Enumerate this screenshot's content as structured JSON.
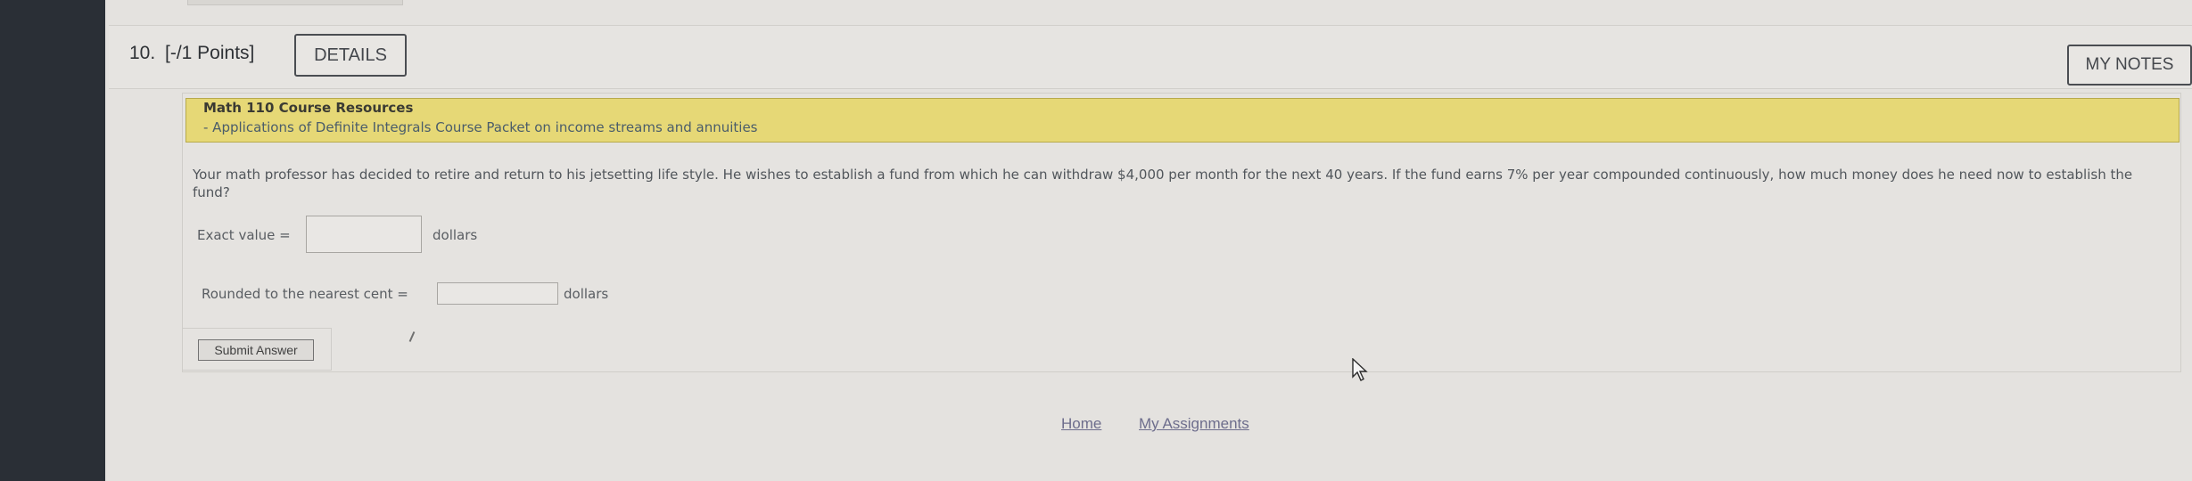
{
  "question": {
    "number": "10.",
    "points": "[-/1 Points]",
    "details_label": "DETAILS",
    "notes_label": "MY NOTES"
  },
  "resources": {
    "title": "Math 110 Course Resources",
    "subtitle": "- Applications of Definite Integrals Course Packet on income streams and annuities"
  },
  "problem": {
    "text": "Your math professor has decided to retire and return to his jetsetting life style. He wishes to establish a fund from which he can withdraw $4,000 per month for the next 40 years. If the fund earns 7% per year compounded continuously, how much money does he need now to establish the fund?",
    "exact_label": "Exact value =",
    "exact_unit": "dollars",
    "rounded_label": "Rounded to the nearest cent =",
    "rounded_unit": "dollars",
    "submit_label": "Submit Answer"
  },
  "footer": {
    "home_label": "Home",
    "assignments_label": "My Assignments"
  }
}
